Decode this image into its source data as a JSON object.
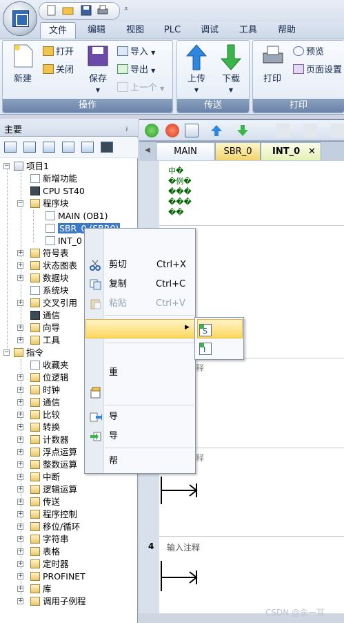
{
  "ribbon": {
    "tabs": [
      "文件",
      "编辑",
      "视图",
      "PLC",
      "调试",
      "工具",
      "帮助"
    ],
    "active_tab": "文件",
    "groups": {
      "operation": {
        "label": "操作",
        "new": "新建",
        "open": "打开",
        "close": "关闭",
        "save": "保存",
        "import": "导入",
        "export": "导出",
        "previous": "上一个"
      },
      "transfer": {
        "label": "传送",
        "upload": "上传",
        "download": "下载"
      },
      "print": {
        "label": "打印",
        "print": "打印",
        "preview": "预览",
        "page_setup": "页面设置"
      }
    }
  },
  "panel": {
    "title": "主要",
    "pin": "ᵖ"
  },
  "tree": {
    "project": "项目1",
    "new_features": "新增功能",
    "cpu": "CPU ST40",
    "program_block": "程序块",
    "main": "MAIN (OB1)",
    "sbr": "SBR_0 (SBR0)",
    "int": "INT_0",
    "symbol_table": "符号表",
    "status_chart": "状态图表",
    "data_block": "数据块",
    "system_block": "系统块",
    "cross_ref": "交叉引用",
    "comm": "通信",
    "wizard": "向导",
    "tools": "工具",
    "instructions": "指令",
    "favorites": "收藏夹",
    "bit_logic": "位逻辑",
    "clock": "时钟",
    "comm2": "通信",
    "compare": "比较",
    "convert": "转换",
    "counter": "计数器",
    "float_math": "浮点运算",
    "int_math": "整数运算",
    "interrupt": "中断",
    "logic_ops": "逻辑运算",
    "transfer": "传送",
    "program_ctrl": "程序控制",
    "shift_rotate": "移位/循环",
    "string": "字符串",
    "table": "表格",
    "timer": "定时器",
    "profinet": "PROFINET",
    "library": "库",
    "call_subroutine": "调用子例程"
  },
  "editor": {
    "tabs": [
      "MAIN",
      "SBR_0",
      "INT_0"
    ],
    "active_tab": "INT_0",
    "close_glyph": "✕",
    "comment_lines": [
      "中�",
      "�例�",
      "���",
      "���",
      "��"
    ],
    "rung4_number": "4",
    "rung_comment_placeholder": "输入注释",
    "partial_char_1": "释",
    "partial_char_2": "释"
  },
  "context_menu": {
    "cut": "剪切",
    "cut_shortcut": "Ctrl+X",
    "copy": "复制",
    "copy_shortcut": "Ctrl+C",
    "paste": "粘贴",
    "paste_shortcut": "Ctrl+V",
    "rename": "重",
    "export": "导",
    "import": "导",
    "help": "帮",
    "submenu_arrow": "▶"
  },
  "watermark": "CSDN @汆一耳",
  "colors": {
    "accent": "#3d79c9",
    "highlight": "#ffd85e",
    "upload_arrow": "#2e86de",
    "download_arrow": "#39b54a"
  }
}
